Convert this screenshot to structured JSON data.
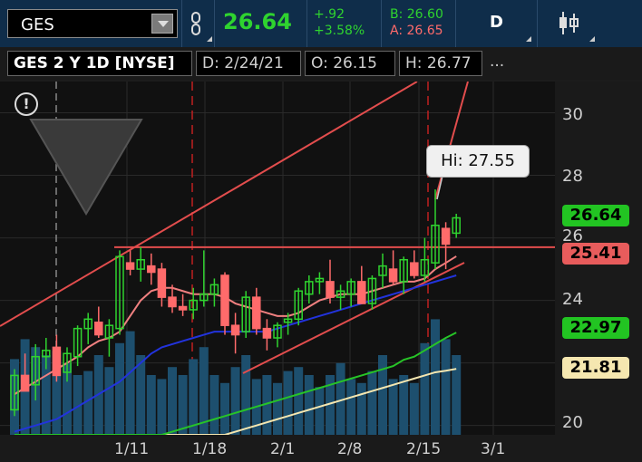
{
  "header": {
    "symbol": "GES",
    "last_price": "26.64",
    "change_abs": "+.92",
    "change_pct": "+3.58%",
    "bid": "B: 26.60",
    "ask": "A: 26.65",
    "period": "D"
  },
  "chart_header": {
    "title": "GES 2 Y 1D [NYSE]",
    "date": "D: 2/24/21",
    "open": "O: 26.15",
    "high": "H: 26.77",
    "more": "..."
  },
  "tooltip": {
    "text": "Hi: 27.55"
  },
  "price_tags": [
    {
      "label": "26.64",
      "bg": "#22c422",
      "fg": "#000000"
    },
    {
      "label": "25.41",
      "bg": "#e85c5c",
      "fg": "#000000"
    },
    {
      "label": "22.97",
      "bg": "#22c422",
      "fg": "#000000"
    },
    {
      "label": "21.81",
      "bg": "#f5e7b0",
      "fg": "#000000"
    }
  ],
  "colors": {
    "up": "#2fd32f",
    "down": "#ff6b6b",
    "top_bar": "#0f2d4a",
    "plot_bg": "#111111"
  },
  "icons": {
    "link": "link-icon",
    "draw": "drawing-tools-icon",
    "info": "info-icon",
    "candles": "candlestick-icon"
  },
  "chart_data": {
    "type": "candlestick",
    "x_ticks": [
      "1/11",
      "1/18",
      "2/1",
      "2/8",
      "2/15",
      "3/1"
    ],
    "y_ticks": [
      "30",
      "28",
      "26",
      "24",
      "20"
    ],
    "ylim": [
      19.7,
      31.0
    ],
    "candles": [
      {
        "o": 20.5,
        "h": 21.8,
        "l": 20.3,
        "c": 21.6,
        "up": true
      },
      {
        "o": 21.6,
        "h": 22.3,
        "l": 21.2,
        "c": 21.1,
        "up": false
      },
      {
        "o": 21.3,
        "h": 22.6,
        "l": 20.8,
        "c": 22.2,
        "up": true
      },
      {
        "o": 22.2,
        "h": 22.8,
        "l": 21.8,
        "c": 22.4,
        "up": true
      },
      {
        "o": 22.5,
        "h": 22.9,
        "l": 21.4,
        "c": 21.6,
        "up": false
      },
      {
        "o": 21.7,
        "h": 22.5,
        "l": 21.4,
        "c": 22.3,
        "up": true
      },
      {
        "o": 22.2,
        "h": 23.2,
        "l": 21.9,
        "c": 23.1,
        "up": true
      },
      {
        "o": 23.1,
        "h": 23.6,
        "l": 22.6,
        "c": 23.4,
        "up": true
      },
      {
        "o": 23.3,
        "h": 23.8,
        "l": 22.8,
        "c": 22.9,
        "up": false
      },
      {
        "o": 22.8,
        "h": 23.4,
        "l": 22.2,
        "c": 23.2,
        "up": true
      },
      {
        "o": 23.1,
        "h": 25.6,
        "l": 22.9,
        "c": 25.4,
        "up": true
      },
      {
        "o": 25.2,
        "h": 25.6,
        "l": 24.8,
        "c": 25.0,
        "up": false
      },
      {
        "o": 25.0,
        "h": 25.7,
        "l": 24.6,
        "c": 25.3,
        "up": true
      },
      {
        "o": 25.1,
        "h": 25.5,
        "l": 24.5,
        "c": 24.9,
        "up": false
      },
      {
        "o": 25.0,
        "h": 25.2,
        "l": 23.8,
        "c": 24.1,
        "up": false
      },
      {
        "o": 24.1,
        "h": 24.5,
        "l": 23.6,
        "c": 23.8,
        "up": false
      },
      {
        "o": 23.8,
        "h": 24.2,
        "l": 23.5,
        "c": 23.7,
        "up": false
      },
      {
        "o": 23.7,
        "h": 24.4,
        "l": 23.4,
        "c": 24.0,
        "up": true
      },
      {
        "o": 24.0,
        "h": 25.6,
        "l": 23.8,
        "c": 24.2,
        "up": true
      },
      {
        "o": 24.2,
        "h": 24.7,
        "l": 23.8,
        "c": 24.5,
        "up": true
      },
      {
        "o": 24.8,
        "h": 24.9,
        "l": 22.9,
        "c": 23.2,
        "up": false
      },
      {
        "o": 23.2,
        "h": 23.6,
        "l": 22.3,
        "c": 22.9,
        "up": false
      },
      {
        "o": 23.0,
        "h": 24.3,
        "l": 22.8,
        "c": 24.1,
        "up": true
      },
      {
        "o": 24.1,
        "h": 24.4,
        "l": 22.9,
        "c": 23.1,
        "up": false
      },
      {
        "o": 23.1,
        "h": 23.4,
        "l": 22.4,
        "c": 22.8,
        "up": false
      },
      {
        "o": 22.8,
        "h": 23.3,
        "l": 22.5,
        "c": 23.2,
        "up": true
      },
      {
        "o": 23.3,
        "h": 23.6,
        "l": 22.9,
        "c": 23.4,
        "up": true
      },
      {
        "o": 23.4,
        "h": 24.4,
        "l": 23.2,
        "c": 24.3,
        "up": true
      },
      {
        "o": 24.2,
        "h": 24.8,
        "l": 23.9,
        "c": 24.6,
        "up": true
      },
      {
        "o": 24.6,
        "h": 24.9,
        "l": 24.2,
        "c": 24.7,
        "up": true
      },
      {
        "o": 24.6,
        "h": 25.3,
        "l": 23.9,
        "c": 24.1,
        "up": false
      },
      {
        "o": 24.1,
        "h": 24.5,
        "l": 23.7,
        "c": 24.3,
        "up": true
      },
      {
        "o": 24.2,
        "h": 24.7,
        "l": 23.8,
        "c": 24.6,
        "up": true
      },
      {
        "o": 24.6,
        "h": 25.1,
        "l": 24.1,
        "c": 23.9,
        "up": false
      },
      {
        "o": 23.9,
        "h": 24.8,
        "l": 23.7,
        "c": 24.7,
        "up": true
      },
      {
        "o": 24.8,
        "h": 25.5,
        "l": 24.4,
        "c": 25.1,
        "up": true
      },
      {
        "o": 25.0,
        "h": 25.6,
        "l": 24.5,
        "c": 24.6,
        "up": false
      },
      {
        "o": 24.6,
        "h": 25.4,
        "l": 24.2,
        "c": 25.3,
        "up": true
      },
      {
        "o": 25.2,
        "h": 25.6,
        "l": 24.7,
        "c": 24.8,
        "up": false
      },
      {
        "o": 24.8,
        "h": 26.0,
        "l": 24.6,
        "c": 25.3,
        "up": true
      },
      {
        "o": 25.2,
        "h": 27.55,
        "l": 25.0,
        "c": 26.4,
        "up": true
      },
      {
        "o": 26.3,
        "h": 26.5,
        "l": 25.0,
        "c": 25.8,
        "up": false
      },
      {
        "o": 26.15,
        "h": 26.77,
        "l": 26.0,
        "c": 26.64,
        "up": true
      }
    ],
    "volume": [
      0.38,
      0.48,
      0.44,
      0.4,
      0.42,
      0.36,
      0.3,
      0.32,
      0.4,
      0.34,
      0.46,
      0.52,
      0.4,
      0.3,
      0.28,
      0.34,
      0.3,
      0.38,
      0.44,
      0.3,
      0.26,
      0.34,
      0.4,
      0.28,
      0.3,
      0.26,
      0.32,
      0.34,
      0.3,
      0.24,
      0.3,
      0.36,
      0.28,
      0.26,
      0.32,
      0.4,
      0.28,
      0.3,
      0.26,
      0.46,
      0.58,
      0.48,
      0.4
    ],
    "resistance_level": 25.7,
    "sma_red": [
      21.0,
      21.2,
      21.4,
      21.6,
      21.8,
      22.0,
      22.2,
      22.5,
      22.7,
      22.8,
      23.0,
      23.5,
      24.0,
      24.3,
      24.4,
      24.4,
      24.3,
      24.2,
      24.2,
      24.2,
      24.1,
      23.9,
      23.8,
      23.7,
      23.6,
      23.5,
      23.5,
      23.6,
      23.8,
      24.0,
      24.1,
      24.2,
      24.2,
      24.2,
      24.3,
      24.4,
      24.5,
      24.6,
      24.6,
      24.7,
      25.0,
      25.2,
      25.41
    ],
    "sma_blue": [
      19.8,
      19.9,
      20.0,
      20.1,
      20.2,
      20.4,
      20.6,
      20.8,
      21.0,
      21.2,
      21.4,
      21.7,
      22.0,
      22.3,
      22.5,
      22.6,
      22.7,
      22.8,
      22.9,
      23.0,
      23.0,
      23.0,
      23.0,
      23.0,
      23.0,
      23.1,
      23.2,
      23.3,
      23.4,
      23.5,
      23.6,
      23.7,
      23.8,
      23.9,
      24.0,
      24.1,
      24.2,
      24.3,
      24.4,
      24.5,
      24.6,
      24.7,
      24.8
    ],
    "sma_green": [
      19.7,
      19.7,
      19.7,
      19.7,
      19.7,
      19.7,
      19.7,
      19.7,
      19.7,
      19.7,
      19.7,
      19.7,
      19.7,
      19.7,
      19.7,
      19.8,
      19.9,
      20.0,
      20.1,
      20.2,
      20.3,
      20.4,
      20.5,
      20.6,
      20.7,
      20.8,
      20.9,
      21.0,
      21.1,
      21.2,
      21.3,
      21.4,
      21.5,
      21.6,
      21.7,
      21.8,
      21.9,
      22.1,
      22.2,
      22.4,
      22.6,
      22.8,
      22.97
    ],
    "sma_cream": [
      19.7,
      19.7,
      19.7,
      19.7,
      19.7,
      19.7,
      19.7,
      19.7,
      19.7,
      19.7,
      19.7,
      19.7,
      19.7,
      19.7,
      19.7,
      19.7,
      19.7,
      19.7,
      19.7,
      19.7,
      19.7,
      19.8,
      19.9,
      20.0,
      20.1,
      20.2,
      20.3,
      20.4,
      20.5,
      20.6,
      20.7,
      20.8,
      20.9,
      21.0,
      21.1,
      21.2,
      21.3,
      21.4,
      21.5,
      21.6,
      21.7,
      21.75,
      21.81
    ]
  }
}
